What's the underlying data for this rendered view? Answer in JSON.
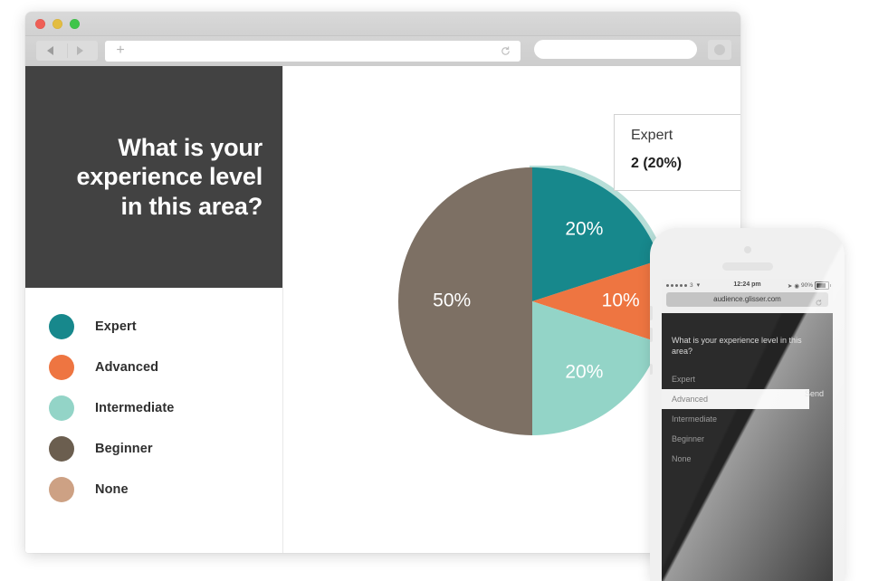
{
  "browser": {
    "traffic_lights": [
      "close",
      "minimize",
      "zoom"
    ],
    "new_tab_label": "+",
    "back_icon": "back-arrow-icon",
    "forward_icon": "forward-arrow-icon",
    "reload_icon": "reload-icon",
    "url_value": "",
    "url_placeholder": ""
  },
  "question": {
    "text": "What is your experience level in this area?"
  },
  "legend": {
    "items": [
      {
        "label": "Expert",
        "color": "#17888c"
      },
      {
        "label": "Advanced",
        "color": "#ee7541"
      },
      {
        "label": "Intermediate",
        "color": "#93d4c7"
      },
      {
        "label": "Beginner",
        "color": "#6b5e4f"
      },
      {
        "label": "None",
        "color": "#cda184"
      }
    ]
  },
  "tooltip": {
    "title": "Expert",
    "value": "2 (20%)"
  },
  "chart_data": {
    "type": "pie",
    "title": "What is your experience level in this area?",
    "categories": [
      "Expert",
      "Advanced",
      "Intermediate",
      "Beginner",
      "None"
    ],
    "values": [
      20,
      10,
      20,
      50,
      0
    ],
    "counts": [
      2,
      1,
      2,
      5,
      0
    ],
    "colors": [
      "#17888c",
      "#ee7541",
      "#93d4c7",
      "#7d7064",
      "#cda184"
    ],
    "labels": [
      "20%",
      "10%",
      "20%",
      "50%",
      ""
    ],
    "highlighted": "Expert",
    "legend_position": "left",
    "grid": false
  },
  "phone": {
    "status": {
      "carrier": "3",
      "signal_dots": 5,
      "wifi_icon": "wifi-icon",
      "time": "12:24 pm",
      "location_icon": "location-arrow-icon",
      "lock_icon": "rotation-lock-icon",
      "battery_percent": "90%"
    },
    "url": "audience.glisser.com",
    "reload_icon": "reload-icon",
    "question": "What is your experience level in this area?",
    "options": [
      {
        "label": "Expert",
        "selected": false
      },
      {
        "label": "Advanced",
        "selected": true
      },
      {
        "label": "Intermediate",
        "selected": false
      },
      {
        "label": "Beginner",
        "selected": false
      },
      {
        "label": "None",
        "selected": false
      }
    ],
    "send_label": "Send"
  }
}
